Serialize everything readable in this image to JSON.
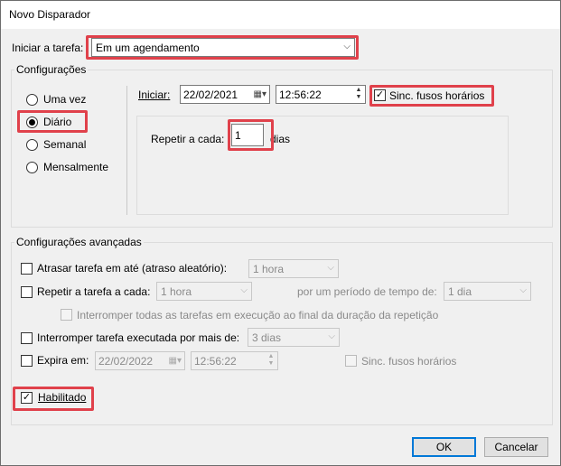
{
  "window": {
    "title": "Novo Disparador",
    "close_glyph": "✕"
  },
  "start_task": {
    "label": "Iniciar a tarefa:",
    "value": "Em um agendamento"
  },
  "settings": {
    "group_title": "Configurações",
    "radios": [
      {
        "label": "Uma vez",
        "selected": false
      },
      {
        "label": "Diário",
        "selected": true
      },
      {
        "label": "Semanal",
        "selected": false
      },
      {
        "label": "Mensalmente",
        "selected": false
      }
    ],
    "start_label": "Iniciar:",
    "start_date": "22/02/2021",
    "start_time": "12:56:22",
    "sync_tz_label": "Sinc. fusos horários",
    "sync_tz_checked": true,
    "repeat_every_label": "Repetir a cada:",
    "repeat_every_value": "1",
    "repeat_every_unit": "dias"
  },
  "advanced": {
    "group_title": "Configurações avançadas",
    "delay_label": "Atrasar tarefa em até (atraso aleatório):",
    "delay_value": "1 hora",
    "repeat_label": "Repetir a tarefa a cada:",
    "repeat_value": "1 hora",
    "duration_label": "por um período de tempo de:",
    "duration_value": "1 dia",
    "stop_all_label": "Interromper todas as tarefas em execução ao final da duração da repetição",
    "stop_longer_label": "Interromper tarefa executada por mais de:",
    "stop_longer_value": "3 dias",
    "expire_label": "Expira em:",
    "expire_date": "22/02/2022",
    "expire_time": "12:56:22",
    "expire_sync_label": "Sinc. fusos horários",
    "enabled_label": "Habilitado",
    "enabled_checked": true
  },
  "buttons": {
    "ok": "OK",
    "cancel": "Cancelar"
  },
  "glyphs": {
    "check": "✓",
    "arrow": "⌵",
    "spin_up": "▲",
    "spin_down": "▼",
    "calendar": "▦▾"
  },
  "colors": {
    "highlight": "#e0414b",
    "default_button_border": "#0078d7"
  }
}
